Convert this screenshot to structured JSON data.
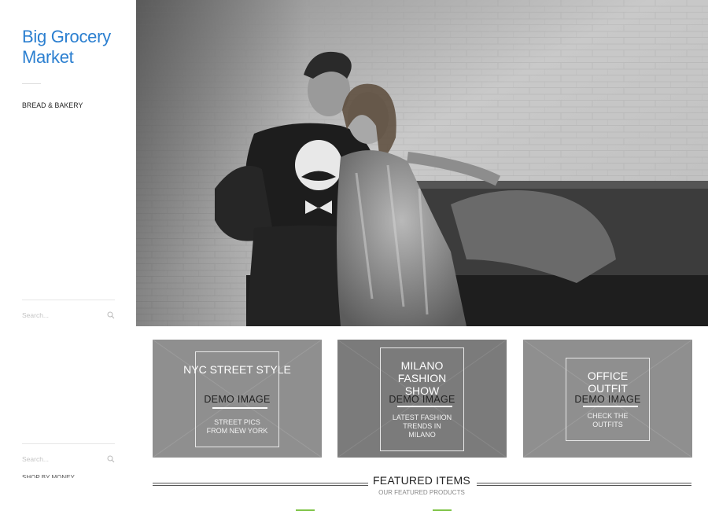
{
  "sidebar": {
    "site_title": "Big Grocery Market",
    "category_link": "BREAD & BAKERY",
    "search_placeholder": "Search...",
    "search2_placeholder": "Search...",
    "clipped_text": "SHOP BY MONEY"
  },
  "hero": {
    "image": "black-and-white fashion photo of a couple sitting on a bench"
  },
  "promos": [
    {
      "headline": "NYC STREET STYLE",
      "demo": "DEMO IMAGE",
      "sub": "STREET PICS FROM NEW YORK"
    },
    {
      "headline": "MILANO FASHION SHOW",
      "demo": "DEMO IMAGE",
      "sub": "LATEST FASHION TRENDS IN MILANO"
    },
    {
      "headline": "OFFICE OUTFIT",
      "demo": "DEMO IMAGE",
      "sub": "CHECK THE OUTFITS"
    }
  ],
  "featured": {
    "title": "FEATURED ITEMS",
    "subtitle": "OUR FEATURED PRODUCTS"
  },
  "colors": {
    "brand": "#2b7fd0",
    "accent_green": "#7cc243",
    "promo_gray": "#8f8f8f",
    "promo_gray_dark": "#7b7b7b"
  }
}
